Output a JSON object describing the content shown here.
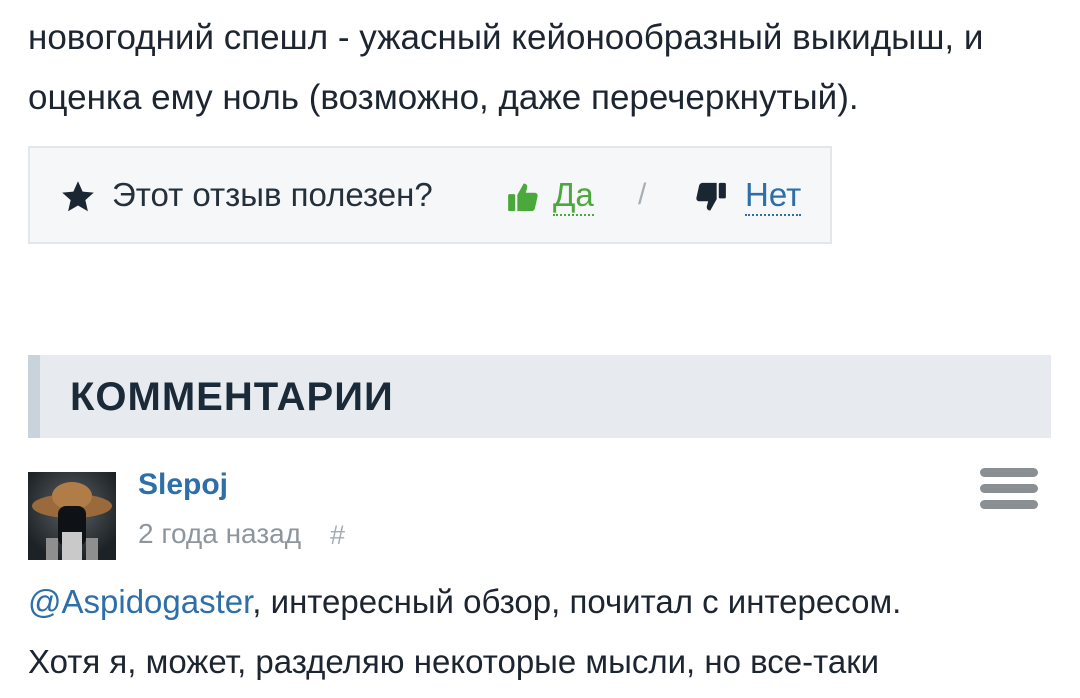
{
  "review": {
    "text_line1": "новогодний спешл - ужасный кейонообразный выкидыш, и",
    "text_line2": "оценка ему ноль (возможно, даже перечеркнутый)."
  },
  "usefulness": {
    "question": "Этот отзыв полезен?",
    "yes_label": "Да",
    "separator": "/",
    "no_label": "Нет",
    "icons": {
      "star": "star-icon",
      "yes": "thumbs-up-icon",
      "no": "thumbs-down-icon"
    },
    "colors": {
      "yes": "#4aa93a",
      "no": "#2d6fa6"
    }
  },
  "comments": {
    "title": "КОММЕНТАРИИ",
    "items": [
      {
        "author": "Slepoj",
        "time": "2 года назад",
        "anchor": "#",
        "mention": "@Aspidogaster",
        "text_after_mention": ", интересный обзор, почитал с интересом.",
        "text_line2": "Хотя я, может, разделяю некоторые мысли, но все-таки"
      }
    ]
  }
}
